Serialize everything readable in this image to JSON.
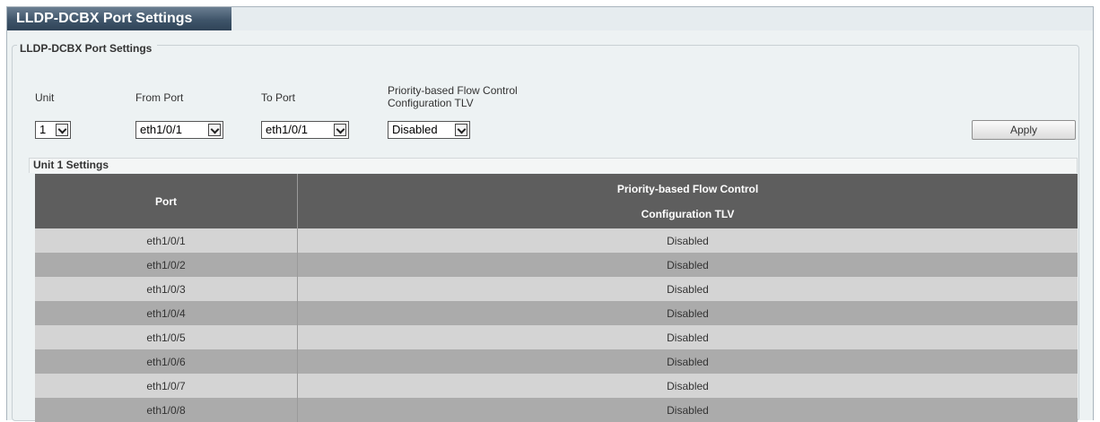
{
  "page": {
    "title": "LLDP-DCBX Port Settings"
  },
  "section": {
    "legend": "LLDP-DCBX Port Settings"
  },
  "form": {
    "unit_label": "Unit",
    "from_port_label": "From Port",
    "to_port_label": "To Port",
    "pfc_label_line1": "Priority-based Flow Control",
    "pfc_label_line2": "Configuration TLV",
    "unit_value": "1",
    "from_port_value": "eth1/0/1",
    "to_port_value": "eth1/0/1",
    "pfc_value": "Disabled",
    "apply_label": "Apply"
  },
  "table": {
    "caption": "Unit 1 Settings",
    "headers": {
      "port": "Port",
      "pfc_line1": "Priority-based Flow Control",
      "pfc_line2": "Configuration TLV"
    },
    "rows": [
      {
        "port": "eth1/0/1",
        "pfc": "Disabled"
      },
      {
        "port": "eth1/0/2",
        "pfc": "Disabled"
      },
      {
        "port": "eth1/0/3",
        "pfc": "Disabled"
      },
      {
        "port": "eth1/0/4",
        "pfc": "Disabled"
      },
      {
        "port": "eth1/0/5",
        "pfc": "Disabled"
      },
      {
        "port": "eth1/0/6",
        "pfc": "Disabled"
      },
      {
        "port": "eth1/0/7",
        "pfc": "Disabled"
      },
      {
        "port": "eth1/0/8",
        "pfc": "Disabled"
      }
    ]
  }
}
